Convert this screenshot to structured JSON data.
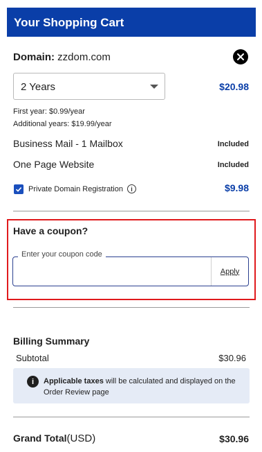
{
  "header": {
    "title": "Your Shopping Cart"
  },
  "domain": {
    "label": "Domain:",
    "name": "zzdom.com"
  },
  "term": {
    "selected": "2 Years",
    "price": "$20.98"
  },
  "notes": {
    "first_year": "First year: $0.99/year",
    "additional_years": "Additional years: $19.99/year"
  },
  "items": [
    {
      "label": "Business Mail - 1 Mailbox",
      "status": "Included"
    },
    {
      "label": "One Page Website",
      "status": "Included"
    }
  ],
  "privacy": {
    "label": "Private Domain Registration",
    "checked": true,
    "price": "$9.98"
  },
  "coupon": {
    "title": "Have a coupon?",
    "placeholder": "Enter your coupon code",
    "value": "",
    "apply_label": "Apply"
  },
  "billing": {
    "title": "Billing Summary",
    "subtotal_label": "Subtotal",
    "subtotal_value": "$30.96",
    "tax_note_bold": "Applicable taxes",
    "tax_note_rest": " will be calculated and displayed on the Order Review page"
  },
  "grand_total": {
    "label": "Grand Total",
    "unit": "(USD)",
    "value": "$30.96"
  },
  "colors": {
    "brand": "#0a3ea8",
    "highlight_border": "#e0191c",
    "info_bg": "#e5ebf6"
  },
  "icons": {
    "close": "close-icon",
    "dropdown": "chevron-down-icon",
    "check": "check-icon",
    "info": "info-icon"
  }
}
